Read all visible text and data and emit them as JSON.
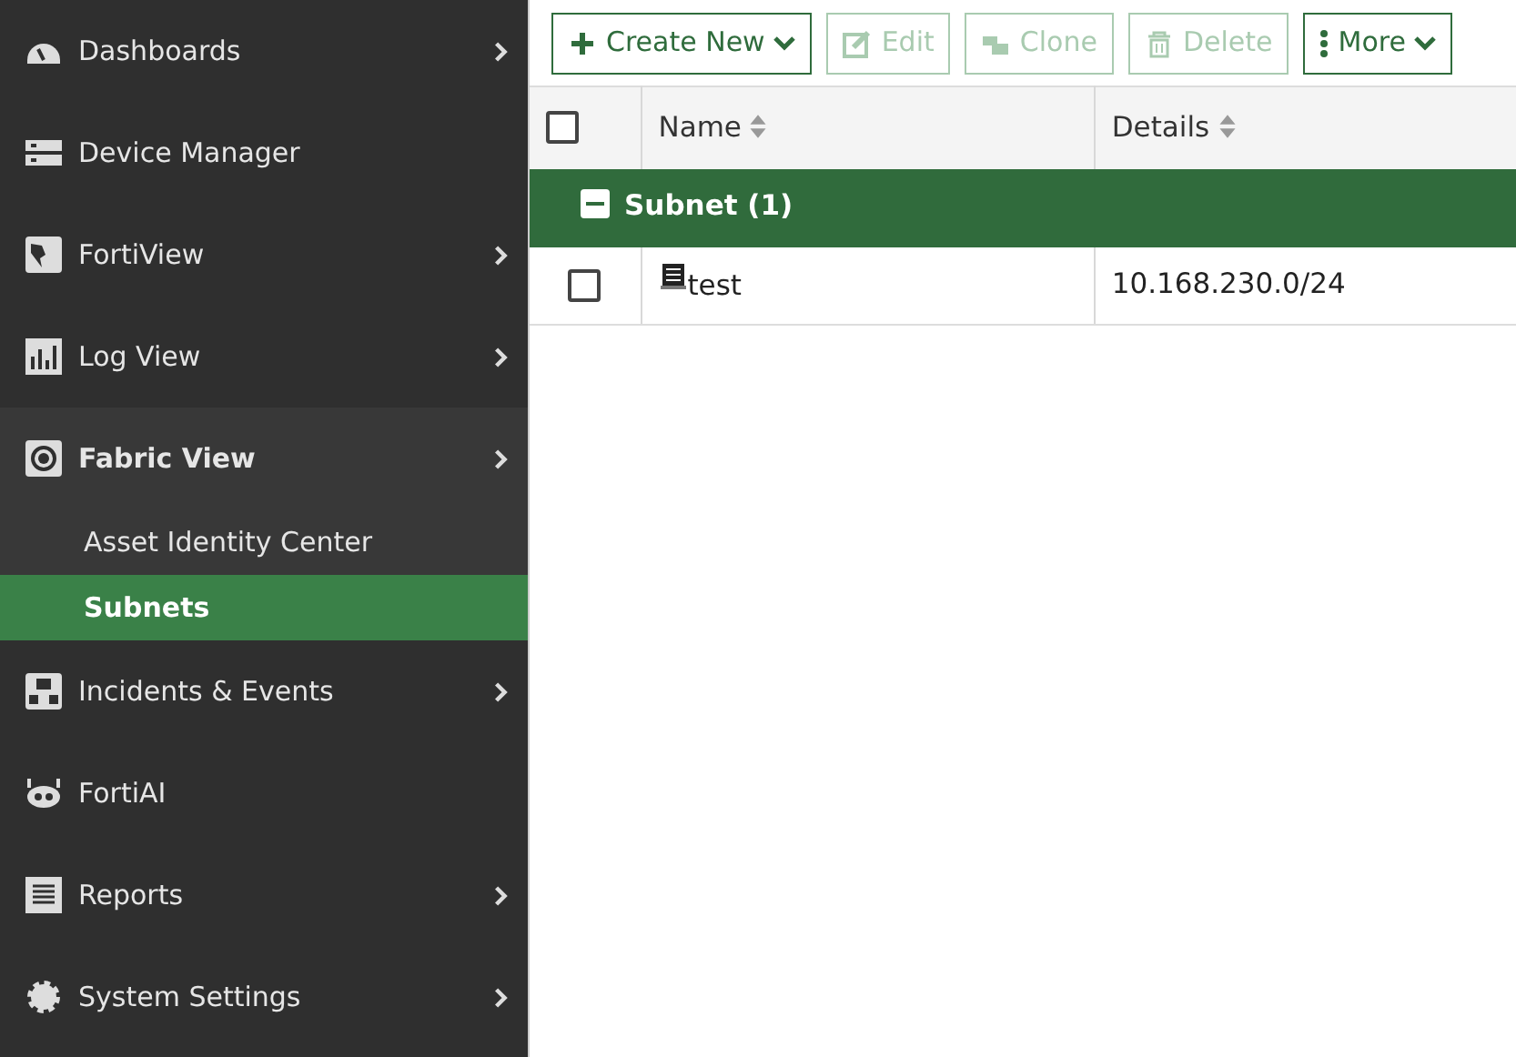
{
  "sidebar": {
    "items": [
      {
        "label": "Dashboards",
        "has_arrow": true,
        "expanded": false
      },
      {
        "label": "Device Manager",
        "has_arrow": false,
        "expanded": false
      },
      {
        "label": "FortiView",
        "has_arrow": true,
        "expanded": false
      },
      {
        "label": "Log View",
        "has_arrow": true,
        "expanded": false
      },
      {
        "label": "Fabric View",
        "has_arrow": true,
        "expanded": true,
        "children": [
          {
            "label": "Asset Identity Center",
            "selected": false
          },
          {
            "label": "Subnets",
            "selected": true
          }
        ]
      },
      {
        "label": "Incidents & Events",
        "has_arrow": true,
        "expanded": false
      },
      {
        "label": "FortiAI",
        "has_arrow": false,
        "expanded": false
      },
      {
        "label": "Reports",
        "has_arrow": true,
        "expanded": false
      },
      {
        "label": "System Settings",
        "has_arrow": true,
        "expanded": false
      }
    ]
  },
  "toolbar": [
    {
      "label": "Create New",
      "disabled": false,
      "has_dropdown": true
    },
    {
      "label": "Edit",
      "disabled": true,
      "has_dropdown": false
    },
    {
      "label": "Clone",
      "disabled": true,
      "has_dropdown": false
    },
    {
      "label": "Delete",
      "disabled": true,
      "has_dropdown": false
    },
    {
      "label": "More",
      "disabled": false,
      "has_dropdown": true
    }
  ],
  "table": {
    "columns": [
      "Name",
      "Details"
    ],
    "groups": [
      {
        "label": "Subnet (1)",
        "expanded": true,
        "rows": [
          {
            "name": "test",
            "details": "10.168.230.0/24",
            "checked": false
          }
        ]
      }
    ],
    "header_checked": false
  }
}
